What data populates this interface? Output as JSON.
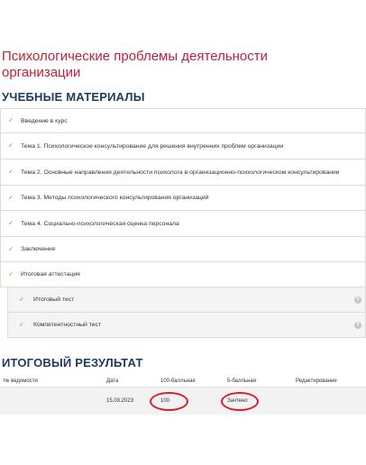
{
  "course": {
    "title": "Психологические проблемы деятельности организации"
  },
  "materials": {
    "heading": "УЧЕБНЫЕ МАТЕРИАЛЫ",
    "check_icon": "checkmark-icon",
    "check_color": "#a8c54a",
    "items": [
      {
        "label": "Введение в курс"
      },
      {
        "label": "Тема 1. Психологическое консультирование для решения внутренних проблем организации"
      },
      {
        "label": "Тема 2. Основные направления деятельности психолога в организационно-психологическом консультировании"
      },
      {
        "label": "Тема 3. Методы психологического консультирования организаций"
      },
      {
        "label": "Тема 4. Социально-психологическая оценка персонала"
      },
      {
        "label": "Заключение"
      },
      {
        "label": "Итоговая аттестация"
      }
    ],
    "sub_items": [
      {
        "label": "Итоговый тест",
        "help": "?"
      },
      {
        "label": "Компетентностный тест",
        "help": "?"
      }
    ]
  },
  "result": {
    "heading": "ИТОГОВЫЙ РЕЗУЛЬТАТ",
    "columns": [
      "№ ведомости",
      "Дата",
      "100-балльная",
      "5-балльная",
      "Редактирование"
    ],
    "row": {
      "sheet": "",
      "date": "15.03.2023",
      "score100": "100",
      "score5": "Зачтено",
      "edit": ""
    },
    "highlight_color": "#d61f2c"
  }
}
